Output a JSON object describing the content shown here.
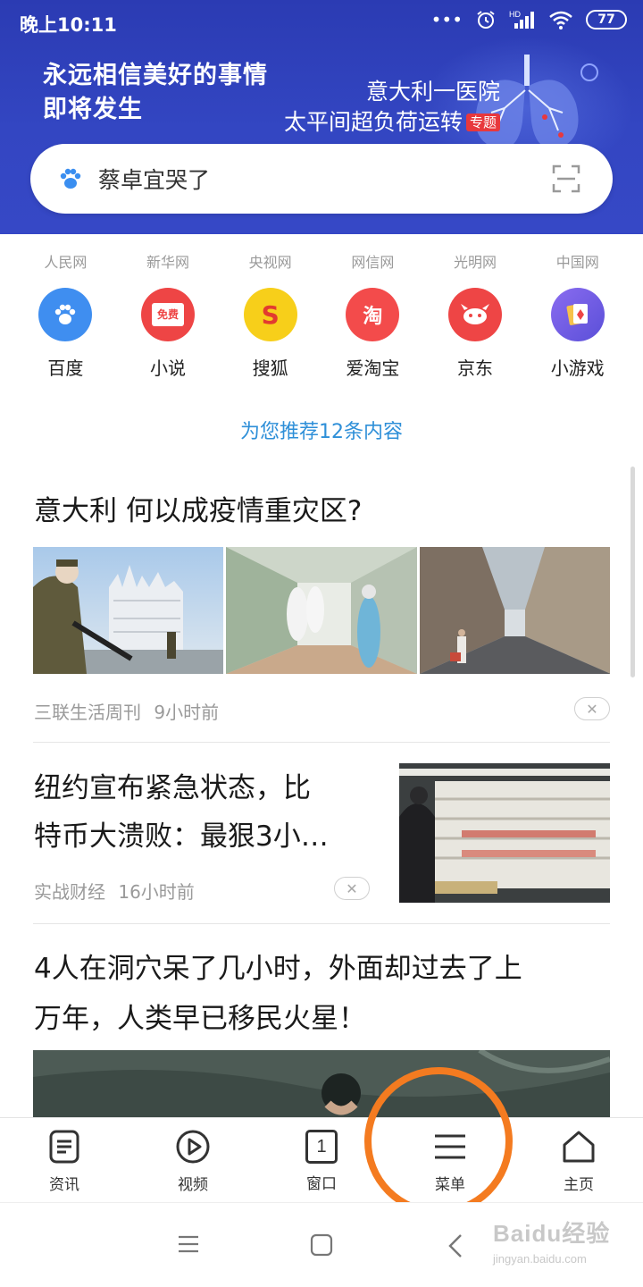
{
  "status_bar": {
    "time": "晚上10:11",
    "signal_label": "HD",
    "battery": "77"
  },
  "banner": {
    "slogan_line1": "永远相信美好的事情",
    "slogan_line2": "即将发生",
    "promo_line1": "意大利一医院",
    "promo_line2": "太平间超负荷运转",
    "promo_tag": "专题",
    "colors": {
      "banner_top": "#2b3bb3",
      "banner_bottom": "#3648c6",
      "tag_red": "#e8383d"
    }
  },
  "search": {
    "query": "蔡卓宜哭了",
    "icons": [
      "paw-icon",
      "scan-icon"
    ]
  },
  "sources": [
    "人民网",
    "新华网",
    "央视网",
    "网信网",
    "光明网",
    "中国网"
  ],
  "apps": [
    {
      "label": "百度",
      "icon": "baidu-paw-icon",
      "color": "#3f8ef0"
    },
    {
      "label": "小说",
      "icon": "novel-book-icon",
      "badge": "免费",
      "color": "#ee4545"
    },
    {
      "label": "搜狐",
      "icon": "sohu-icon",
      "glyph": "S",
      "color": "#f7cf1a"
    },
    {
      "label": "爱淘宝",
      "icon": "taobao-icon",
      "glyph": "淘",
      "color": "#f34b4b"
    },
    {
      "label": "京东",
      "icon": "jd-dog-icon",
      "color": "#ee4545"
    },
    {
      "label": "小游戏",
      "icon": "game-cards-icon",
      "color": "#6b5fe0"
    }
  ],
  "recommend_text": "为您推荐12条内容",
  "feed": [
    {
      "title": "意大利 何以成疫情重灾区?",
      "source": "三联生活周刊",
      "time": "9小时前"
    },
    {
      "title_line1": "纽约宣布紧急状态，比",
      "title_line2": "特币大溃败：最狠3小…",
      "source": "实战财经",
      "time": "16小时前"
    },
    {
      "title_line1": "4人在洞穴呆了几小时，外面却过去了上",
      "title_line2": "万年，人类早已移民火星！"
    }
  ],
  "close_glyph": "✕",
  "toolbar": [
    {
      "label": "资讯",
      "icon": "news-icon"
    },
    {
      "label": "视频",
      "icon": "video-play-icon"
    },
    {
      "label": "窗口",
      "icon": "window-count-icon",
      "count": "1"
    },
    {
      "label": "菜单",
      "icon": "menu-icon"
    },
    {
      "label": "主页",
      "icon": "home-icon"
    }
  ],
  "annotation_color": "#f47b20",
  "watermark": {
    "main": "Baidu经验",
    "sub": "jingyan.baidu.com"
  }
}
